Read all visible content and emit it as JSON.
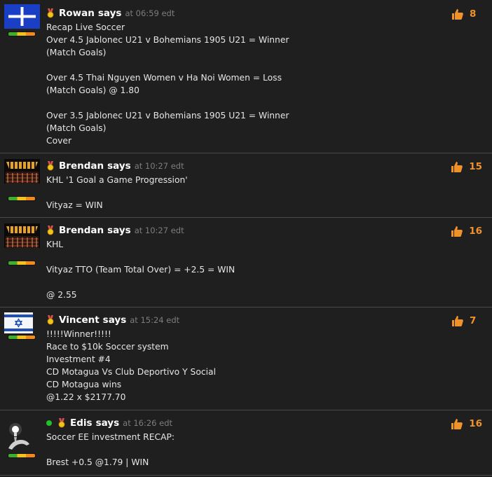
{
  "comments": [
    {
      "author": "Rowan",
      "says": "says",
      "time": "at 06:59 edt",
      "likes": "8",
      "avatar": "eureka-flag",
      "online": false,
      "text": "Recap Live Soccer\nOver 4.5 Jablonec U21 v Bohemians 1905 U21 = Winner\n(Match Goals)\n\nOver 4.5 Thai Nguyen Women v Ha Noi Women = Loss\n(Match Goals) @ 1.80\n\nOver 3.5 Jablonec U21 v Bohemians 1905 U21 = Winner\n(Match Goals)\nCover"
    },
    {
      "author": "Brendan",
      "says": "says",
      "time": "at 10:27 edt",
      "likes": "15",
      "avatar": "stadium-crowd",
      "online": false,
      "text": "KHL '1 Goal a Game Progression'\n\nVityaz = WIN"
    },
    {
      "author": "Brendan",
      "says": "says",
      "time": "at 10:27 edt",
      "likes": "16",
      "avatar": "stadium-crowd",
      "online": false,
      "text": "KHL\n\nVityaz TTO (Team Total Over) = +2.5 = WIN\n\n@ 2.55"
    },
    {
      "author": "Vincent",
      "says": "says",
      "time": "at 15:24 edt",
      "likes": "7",
      "avatar": "israel-flag",
      "online": false,
      "text": "!!!!!Winner!!!!!\nRace to $10k Soccer system\nInvestment #4\nCD Motagua Vs Club Deportivo Y Social\nCD Motagua wins\n@1.22 x $2177.70"
    },
    {
      "author": "Edis",
      "says": "says",
      "time": "at 16:26 edt",
      "likes": "16",
      "avatar": "lightbulb-hand",
      "online": true,
      "text": "Soccer EE investment RECAP:\n\nBrest +0.5 @1.79 | WIN"
    }
  ],
  "colors": {
    "background": "#1f1f1f",
    "like_count": "#f0922a",
    "timestamp": "#7d7d7d",
    "online": "#22c02a"
  }
}
